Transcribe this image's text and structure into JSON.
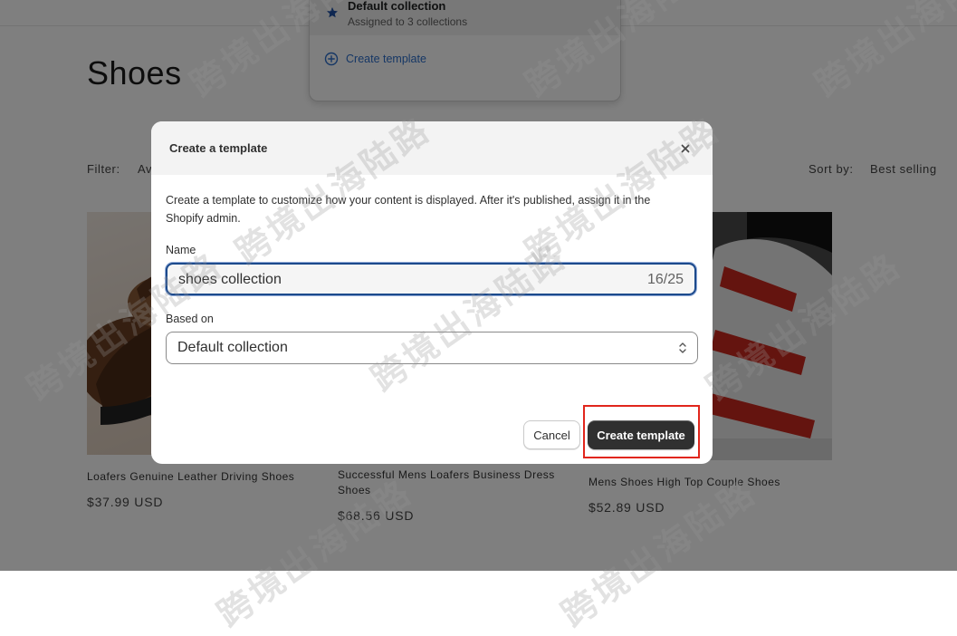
{
  "page": {
    "title": "Shoes",
    "filter_label": "Filter:",
    "filter_partial": "Av",
    "sort_label": "Sort by:",
    "sort_value": "Best selling"
  },
  "products": [
    {
      "title": "Loafers Genuine Leather Driving Shoes",
      "price": "$37.99 USD"
    },
    {
      "title_line1": "Successful Mens Loafers Business Dress",
      "title_line2": "Shoes",
      "price": "$68.56 USD"
    },
    {
      "title": "Mens Shoes High Top Couple Shoes",
      "price": "$52.89 USD"
    }
  ],
  "template_dropdown": {
    "item_title": "Default collection",
    "item_subtitle": "Assigned to 3 collections",
    "create_link": "Create template",
    "star_icon_color": "#1f4fa3",
    "link_color": "#2c6ecb"
  },
  "modal": {
    "title": "Create a template",
    "description": "Create a template to customize how your content is displayed. After it's published, assign it in the Shopify admin.",
    "name_label": "Name",
    "name_value": "shoes collection",
    "name_counter": "16/25",
    "based_on_label": "Based on",
    "based_on_value": "Default collection",
    "cancel_label": "Cancel",
    "create_label": "Create template",
    "primary_color": "#303030",
    "highlight_color": "#e1261c"
  },
  "watermark_text": "跨境出海陆路"
}
